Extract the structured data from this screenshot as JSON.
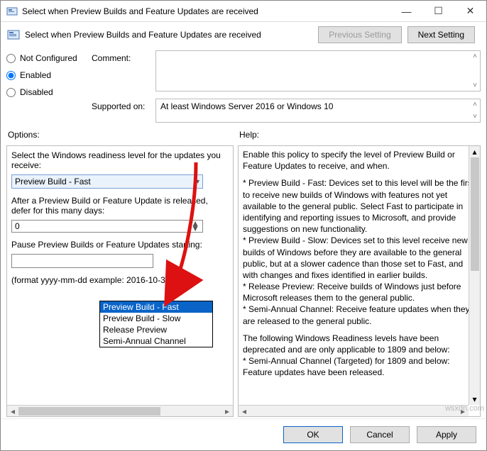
{
  "window": {
    "title": "Select when Preview Builds and Feature Updates are received",
    "subheader": "Select when Preview Builds and Feature Updates are received"
  },
  "nav": {
    "previous": "Previous Setting",
    "next": "Next Setting"
  },
  "radios": {
    "not_configured": "Not Configured",
    "enabled": "Enabled",
    "disabled": "Disabled"
  },
  "fields": {
    "comment_label": "Comment:",
    "supported_label": "Supported on:",
    "supported_value": "At least Windows Server 2016 or Windows 10"
  },
  "pane_labels": {
    "options": "Options:",
    "help": "Help:"
  },
  "options": {
    "readiness_label": "Select the Windows readiness level for the updates you receive:",
    "readiness_value": "Preview Build - Fast",
    "defer_label": "After a Preview Build or Feature Update is released, defer for this many days:",
    "defer_value": "0",
    "pause_label": "Pause Preview Builds or Feature Updates starting:",
    "pause_value": "",
    "format_hint": "(format yyyy-mm-dd example: 2016-10-30)",
    "dropdown_items": [
      "Preview Build - Fast",
      "Preview Build - Slow",
      "Release Preview",
      "Semi-Annual Channel"
    ]
  },
  "help_text": {
    "p1": "Enable this policy to specify the level of Preview Build or Feature Updates to receive, and when.",
    "p2": "* Preview Build - Fast: Devices set to this level will be the first to receive new builds of Windows with features not yet available to the general public. Select Fast to participate in identifying and reporting issues to Microsoft, and provide suggestions on new functionality.",
    "p3": "* Preview Build - Slow: Devices set to this level receive new builds of Windows before they are available to the general public, but at a slower cadence than those set to Fast, and with changes and fixes identified in earlier builds.",
    "p4": "* Release Preview: Receive builds of Windows just before Microsoft releases them to the general public.",
    "p5": "* Semi-Annual Channel: Receive feature updates when they are released to the general public.",
    "p6": "The following Windows Readiness levels have been deprecated and are only applicable to 1809 and below:",
    "p7": "* Semi-Annual Channel (Targeted) for 1809 and below: Feature updates have been released."
  },
  "footer": {
    "ok": "OK",
    "cancel": "Cancel",
    "apply": "Apply"
  },
  "watermark": "wsxdn.com"
}
